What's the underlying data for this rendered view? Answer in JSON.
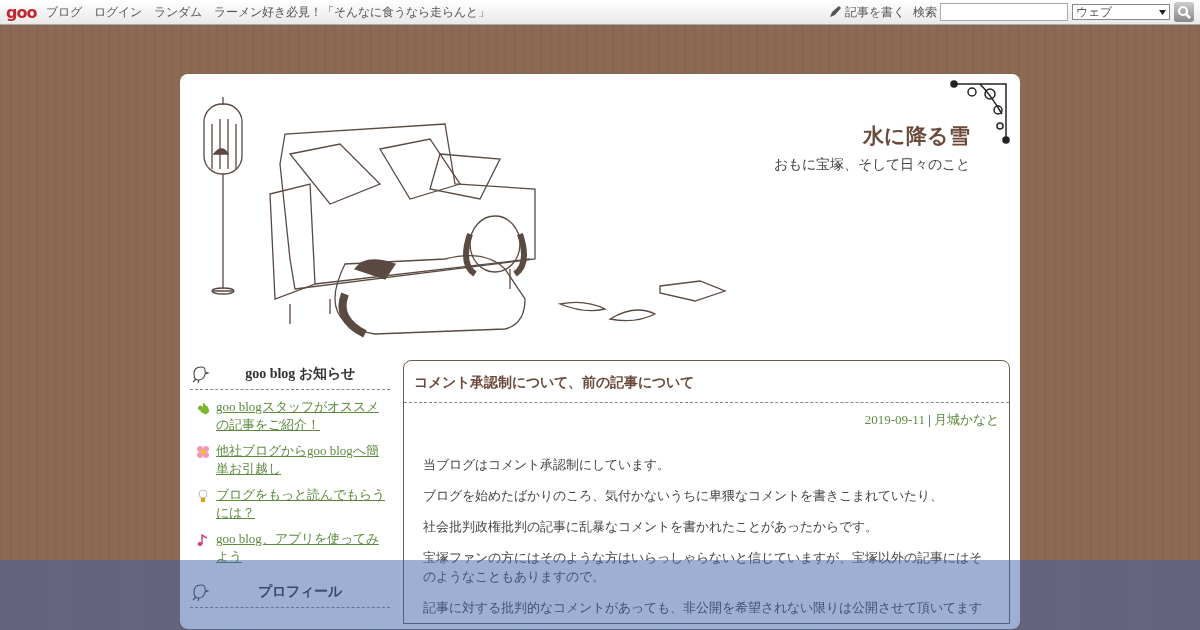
{
  "topbar": {
    "logo": "goo",
    "links": [
      "ブログ",
      "ログイン",
      "ランダム",
      "ラーメン好き必見！「そんなに食うなら走らんと」"
    ],
    "write_link": "記事を書く",
    "search_label": "検索",
    "search_scope": "ウェブ"
  },
  "blog": {
    "title": "水に降る雪",
    "subtitle": "おもに宝塚、そして日々のこと"
  },
  "sidebar": {
    "sections": [
      {
        "title": "goo blog お知らせ",
        "items": [
          "goo blogスタッフがオススメの記事をご紹介！",
          "他社ブログからgoo blogへ簡単お引越し",
          "ブログをもっと読んでもらうには？",
          "goo blog、アプリを使ってみよう"
        ]
      },
      {
        "title": "プロフィール"
      }
    ]
  },
  "article": {
    "title": "コメント承認制について、前の記事について",
    "date": "2019-09-11",
    "separator": "|",
    "author": "月城かなと",
    "paragraphs": [
      "当ブログはコメント承認制にしています。",
      "ブログを始めたばかりのころ、気付かないうちに卑猥なコメントを書きこまれていたり、",
      "社会批判政権批判の記事に乱暴なコメントを書かれたことがあったからです。",
      "宝塚ファンの方にはそのような方はいらっしゃらないと信じていますが、宝塚以外の記事にはそのようなこともありますので。",
      "記事に対する批判的なコメントがあっても、非公開を希望されない限りは公開させて頂いてます"
    ]
  }
}
